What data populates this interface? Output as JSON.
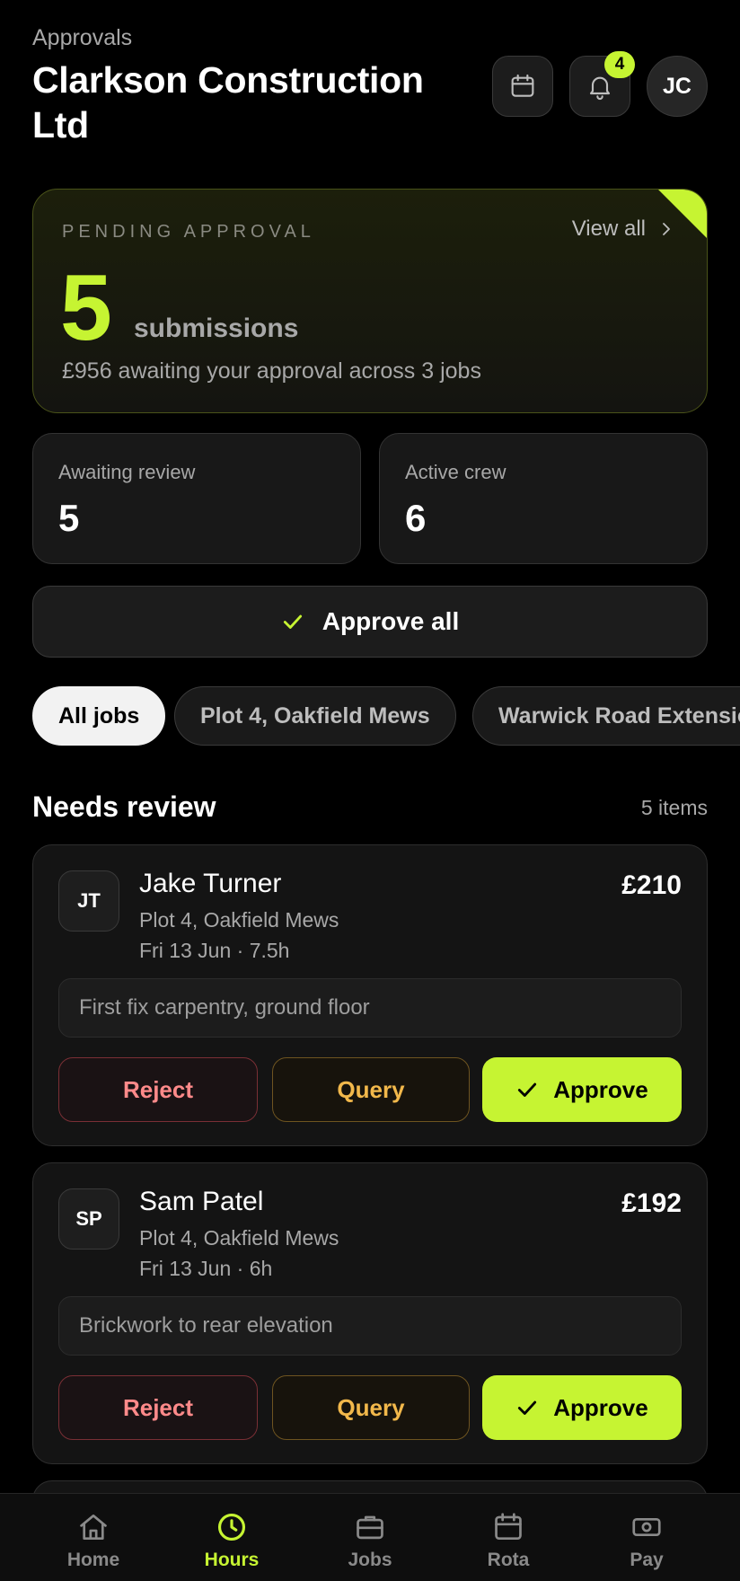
{
  "header": {
    "eyebrow": "Approvals",
    "company": "Clarkson Construction Ltd",
    "notification_count": "4",
    "avatar_initials": "JC"
  },
  "hero": {
    "label": "PENDING APPROVAL",
    "view_all": "View all",
    "count": "5",
    "count_unit": "submissions",
    "description": "£956 awaiting your approval across 3 jobs"
  },
  "stats": [
    {
      "label": "Awaiting review",
      "value": "5"
    },
    {
      "label": "Active crew",
      "value": "6"
    }
  ],
  "approve_all_label": "Approve all",
  "filters": [
    {
      "label": "All jobs",
      "active": true
    },
    {
      "label": "Plot 4, Oakfield Mews",
      "active": false
    },
    {
      "label": "Warwick Road Extension",
      "active": false
    }
  ],
  "section": {
    "title": "Needs review",
    "count": "5 items"
  },
  "submissions": [
    {
      "initials": "JT",
      "name": "Jake Turner",
      "job": "Plot 4, Oakfield Mews",
      "meta": "Fri 13 Jun · 7.5h",
      "amount": "£210",
      "note": "First fix carpentry, ground floor"
    },
    {
      "initials": "SP",
      "name": "Sam Patel",
      "job": "Plot 4, Oakfield Mews",
      "meta": "Fri 13 Jun · 6h",
      "amount": "£192",
      "note": "Brickwork to rear elevation"
    }
  ],
  "actions": {
    "reject": "Reject",
    "query": "Query",
    "approve": "Approve"
  },
  "tabs": [
    {
      "label": "Home",
      "icon": "home-icon",
      "active": false
    },
    {
      "label": "Hours",
      "icon": "clock-icon",
      "active": true
    },
    {
      "label": "Jobs",
      "icon": "briefcase-icon",
      "active": false
    },
    {
      "label": "Rota",
      "icon": "calendar-icon",
      "active": false
    },
    {
      "label": "Pay",
      "icon": "banknote-icon",
      "active": false
    }
  ],
  "colors": {
    "accent": "#c6f432",
    "reject": "#ff8a8a",
    "query": "#f2b84b",
    "background": "#000000"
  }
}
